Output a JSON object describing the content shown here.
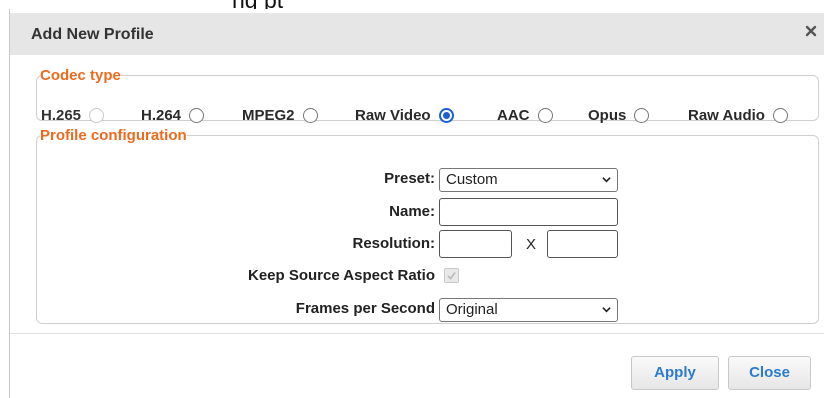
{
  "background_heading": "ng       pt",
  "dialog": {
    "title": "Add New Profile",
    "close_icon": "close-icon"
  },
  "codec_type": {
    "legend": "Codec type",
    "options": [
      {
        "label": "H.265",
        "checked": false,
        "disabled": true
      },
      {
        "label": "H.264",
        "checked": false,
        "disabled": false
      },
      {
        "label": "MPEG2",
        "checked": false,
        "disabled": false
      },
      {
        "label": "Raw Video",
        "checked": true,
        "disabled": false
      },
      {
        "label": "AAC",
        "checked": false,
        "disabled": false
      },
      {
        "label": "Opus",
        "checked": false,
        "disabled": false
      },
      {
        "label": "Raw Audio",
        "checked": false,
        "disabled": false
      }
    ]
  },
  "profile_config": {
    "legend": "Profile configuration",
    "preset_label": "Preset:",
    "preset_value": "Custom",
    "name_label": "Name:",
    "name_value": "",
    "resolution_label": "Resolution:",
    "resolution_width": "",
    "resolution_separator": "X",
    "resolution_height": "",
    "aspect_label": "Keep Source Aspect Ratio",
    "aspect_checked": true,
    "fps_label": "Frames per Second",
    "fps_value": "Original"
  },
  "buttons": {
    "apply": "Apply",
    "close": "Close"
  },
  "colors": {
    "legend": "#ec6b1e",
    "button_text": "#2b7bd0",
    "radio_checked": "#1a5fd6"
  }
}
